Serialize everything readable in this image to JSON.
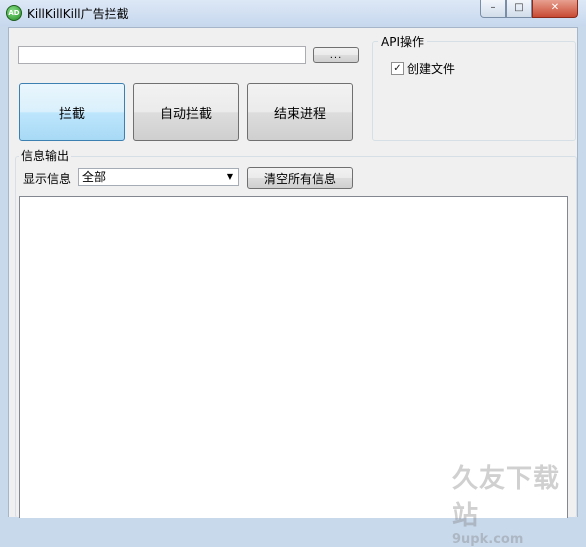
{
  "window": {
    "title": "KillKillKill广告拦截",
    "icon_text": "AD",
    "icon": "app-logo-icon",
    "controls": {
      "minimize": "–",
      "maximize": "□",
      "close": "✕"
    }
  },
  "toolbar": {
    "path_value": "",
    "browse_label": "..."
  },
  "actions": {
    "intercept_label": "拦截",
    "auto_intercept_label": "自动拦截",
    "end_process_label": "结束进程"
  },
  "api_group": {
    "title": "API操作",
    "create_file": {
      "label": "创建文件",
      "checked": true,
      "mark": "✓"
    }
  },
  "info": {
    "group_title": "信息输出",
    "show_label": "显示信息",
    "filter_selected": "全部",
    "clear_label": "清空所有信息",
    "log_text": ""
  },
  "watermark": {
    "main": "久友下载站",
    "sub": "9upk.com"
  },
  "colors": {
    "title_bar": "#c7d8ee",
    "client_bg": "#f0f0f0",
    "close_button": "#c74a33",
    "active_button_border": "#3c7fb1"
  }
}
